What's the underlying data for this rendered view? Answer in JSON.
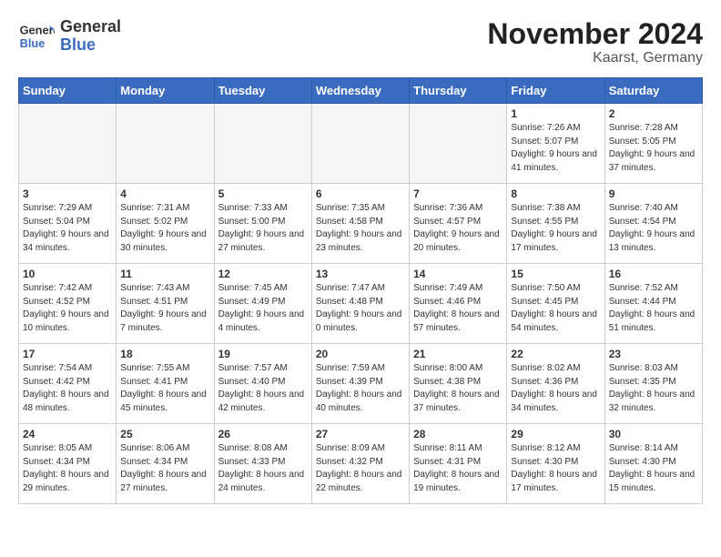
{
  "header": {
    "logo_general": "General",
    "logo_blue": "Blue",
    "month_title": "November 2024",
    "location": "Kaarst, Germany"
  },
  "weekdays": [
    "Sunday",
    "Monday",
    "Tuesday",
    "Wednesday",
    "Thursday",
    "Friday",
    "Saturday"
  ],
  "weeks": [
    [
      {
        "day": "",
        "empty": true
      },
      {
        "day": "",
        "empty": true
      },
      {
        "day": "",
        "empty": true
      },
      {
        "day": "",
        "empty": true
      },
      {
        "day": "",
        "empty": true
      },
      {
        "day": "1",
        "sunrise": "7:26 AM",
        "sunset": "5:07 PM",
        "daylight": "9 hours and 41 minutes."
      },
      {
        "day": "2",
        "sunrise": "7:28 AM",
        "sunset": "5:05 PM",
        "daylight": "9 hours and 37 minutes."
      }
    ],
    [
      {
        "day": "3",
        "sunrise": "7:29 AM",
        "sunset": "5:04 PM",
        "daylight": "9 hours and 34 minutes."
      },
      {
        "day": "4",
        "sunrise": "7:31 AM",
        "sunset": "5:02 PM",
        "daylight": "9 hours and 30 minutes."
      },
      {
        "day": "5",
        "sunrise": "7:33 AM",
        "sunset": "5:00 PM",
        "daylight": "9 hours and 27 minutes."
      },
      {
        "day": "6",
        "sunrise": "7:35 AM",
        "sunset": "4:58 PM",
        "daylight": "9 hours and 23 minutes."
      },
      {
        "day": "7",
        "sunrise": "7:36 AM",
        "sunset": "4:57 PM",
        "daylight": "9 hours and 20 minutes."
      },
      {
        "day": "8",
        "sunrise": "7:38 AM",
        "sunset": "4:55 PM",
        "daylight": "9 hours and 17 minutes."
      },
      {
        "day": "9",
        "sunrise": "7:40 AM",
        "sunset": "4:54 PM",
        "daylight": "9 hours and 13 minutes."
      }
    ],
    [
      {
        "day": "10",
        "sunrise": "7:42 AM",
        "sunset": "4:52 PM",
        "daylight": "9 hours and 10 minutes."
      },
      {
        "day": "11",
        "sunrise": "7:43 AM",
        "sunset": "4:51 PM",
        "daylight": "9 hours and 7 minutes."
      },
      {
        "day": "12",
        "sunrise": "7:45 AM",
        "sunset": "4:49 PM",
        "daylight": "9 hours and 4 minutes."
      },
      {
        "day": "13",
        "sunrise": "7:47 AM",
        "sunset": "4:48 PM",
        "daylight": "9 hours and 0 minutes."
      },
      {
        "day": "14",
        "sunrise": "7:49 AM",
        "sunset": "4:46 PM",
        "daylight": "8 hours and 57 minutes."
      },
      {
        "day": "15",
        "sunrise": "7:50 AM",
        "sunset": "4:45 PM",
        "daylight": "8 hours and 54 minutes."
      },
      {
        "day": "16",
        "sunrise": "7:52 AM",
        "sunset": "4:44 PM",
        "daylight": "8 hours and 51 minutes."
      }
    ],
    [
      {
        "day": "17",
        "sunrise": "7:54 AM",
        "sunset": "4:42 PM",
        "daylight": "8 hours and 48 minutes."
      },
      {
        "day": "18",
        "sunrise": "7:55 AM",
        "sunset": "4:41 PM",
        "daylight": "8 hours and 45 minutes."
      },
      {
        "day": "19",
        "sunrise": "7:57 AM",
        "sunset": "4:40 PM",
        "daylight": "8 hours and 42 minutes."
      },
      {
        "day": "20",
        "sunrise": "7:59 AM",
        "sunset": "4:39 PM",
        "daylight": "8 hours and 40 minutes."
      },
      {
        "day": "21",
        "sunrise": "8:00 AM",
        "sunset": "4:38 PM",
        "daylight": "8 hours and 37 minutes."
      },
      {
        "day": "22",
        "sunrise": "8:02 AM",
        "sunset": "4:36 PM",
        "daylight": "8 hours and 34 minutes."
      },
      {
        "day": "23",
        "sunrise": "8:03 AM",
        "sunset": "4:35 PM",
        "daylight": "8 hours and 32 minutes."
      }
    ],
    [
      {
        "day": "24",
        "sunrise": "8:05 AM",
        "sunset": "4:34 PM",
        "daylight": "8 hours and 29 minutes."
      },
      {
        "day": "25",
        "sunrise": "8:06 AM",
        "sunset": "4:34 PM",
        "daylight": "8 hours and 27 minutes."
      },
      {
        "day": "26",
        "sunrise": "8:08 AM",
        "sunset": "4:33 PM",
        "daylight": "8 hours and 24 minutes."
      },
      {
        "day": "27",
        "sunrise": "8:09 AM",
        "sunset": "4:32 PM",
        "daylight": "8 hours and 22 minutes."
      },
      {
        "day": "28",
        "sunrise": "8:11 AM",
        "sunset": "4:31 PM",
        "daylight": "8 hours and 19 minutes."
      },
      {
        "day": "29",
        "sunrise": "8:12 AM",
        "sunset": "4:30 PM",
        "daylight": "8 hours and 17 minutes."
      },
      {
        "day": "30",
        "sunrise": "8:14 AM",
        "sunset": "4:30 PM",
        "daylight": "8 hours and 15 minutes."
      }
    ]
  ]
}
